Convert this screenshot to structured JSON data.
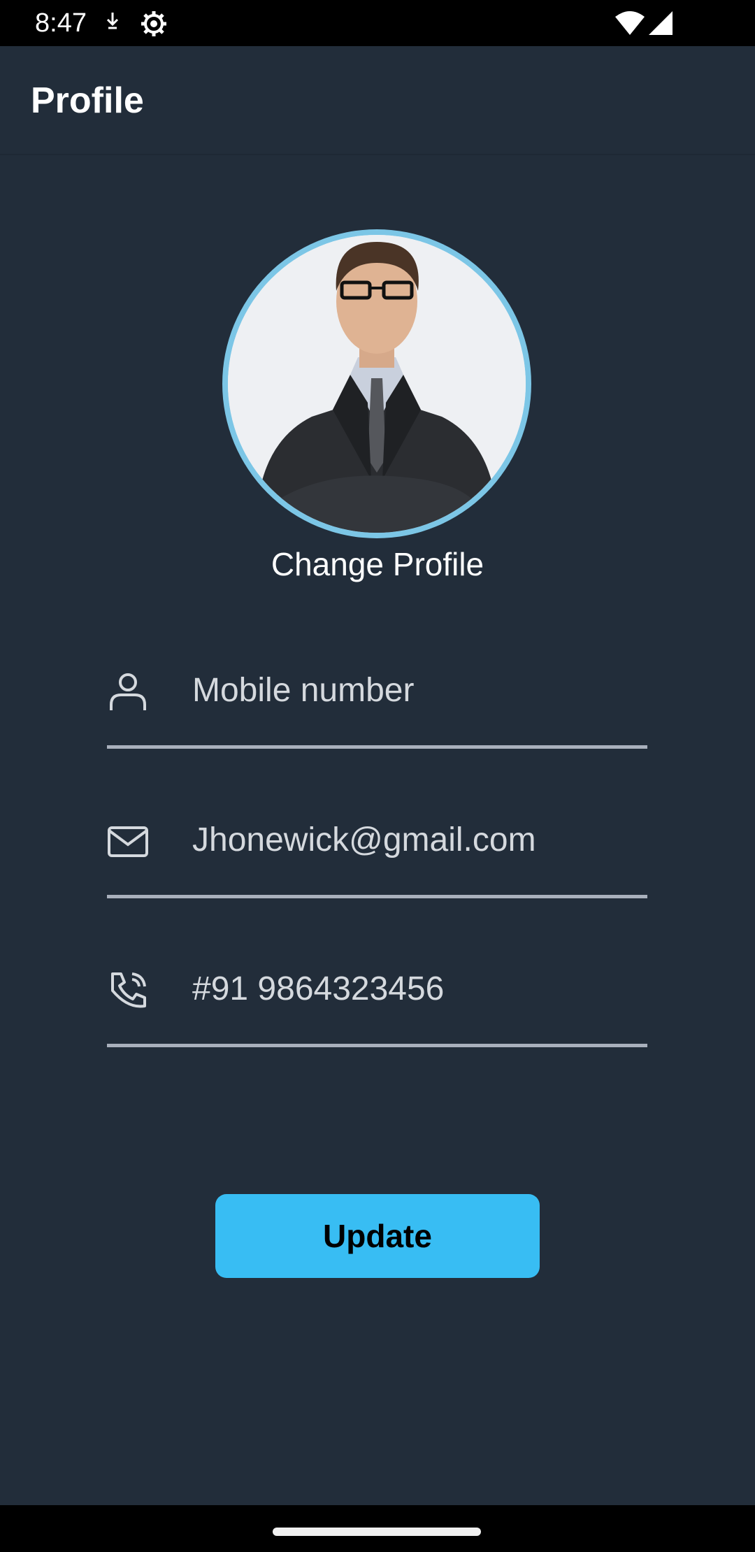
{
  "status_bar": {
    "time": "8:47",
    "icons": [
      "download-icon",
      "settings-gear-icon",
      "wifi-icon",
      "cell-signal-icon"
    ]
  },
  "app_bar": {
    "title": "Profile"
  },
  "profile": {
    "avatar_alt": "profile-photo",
    "change_label": "Change Profile"
  },
  "form": {
    "fields": [
      {
        "icon": "person-icon",
        "value": "Mobile number"
      },
      {
        "icon": "mail-icon",
        "value": "Jhonewick@gmail.com"
      },
      {
        "icon": "phone-icon",
        "value": "#91 9864323456"
      }
    ],
    "update_label": "Update"
  },
  "colors": {
    "background": "#222d3a",
    "accent": "#38bdf3",
    "avatar_ring": "#7cc6e6",
    "underline": "#a9b0bc"
  }
}
